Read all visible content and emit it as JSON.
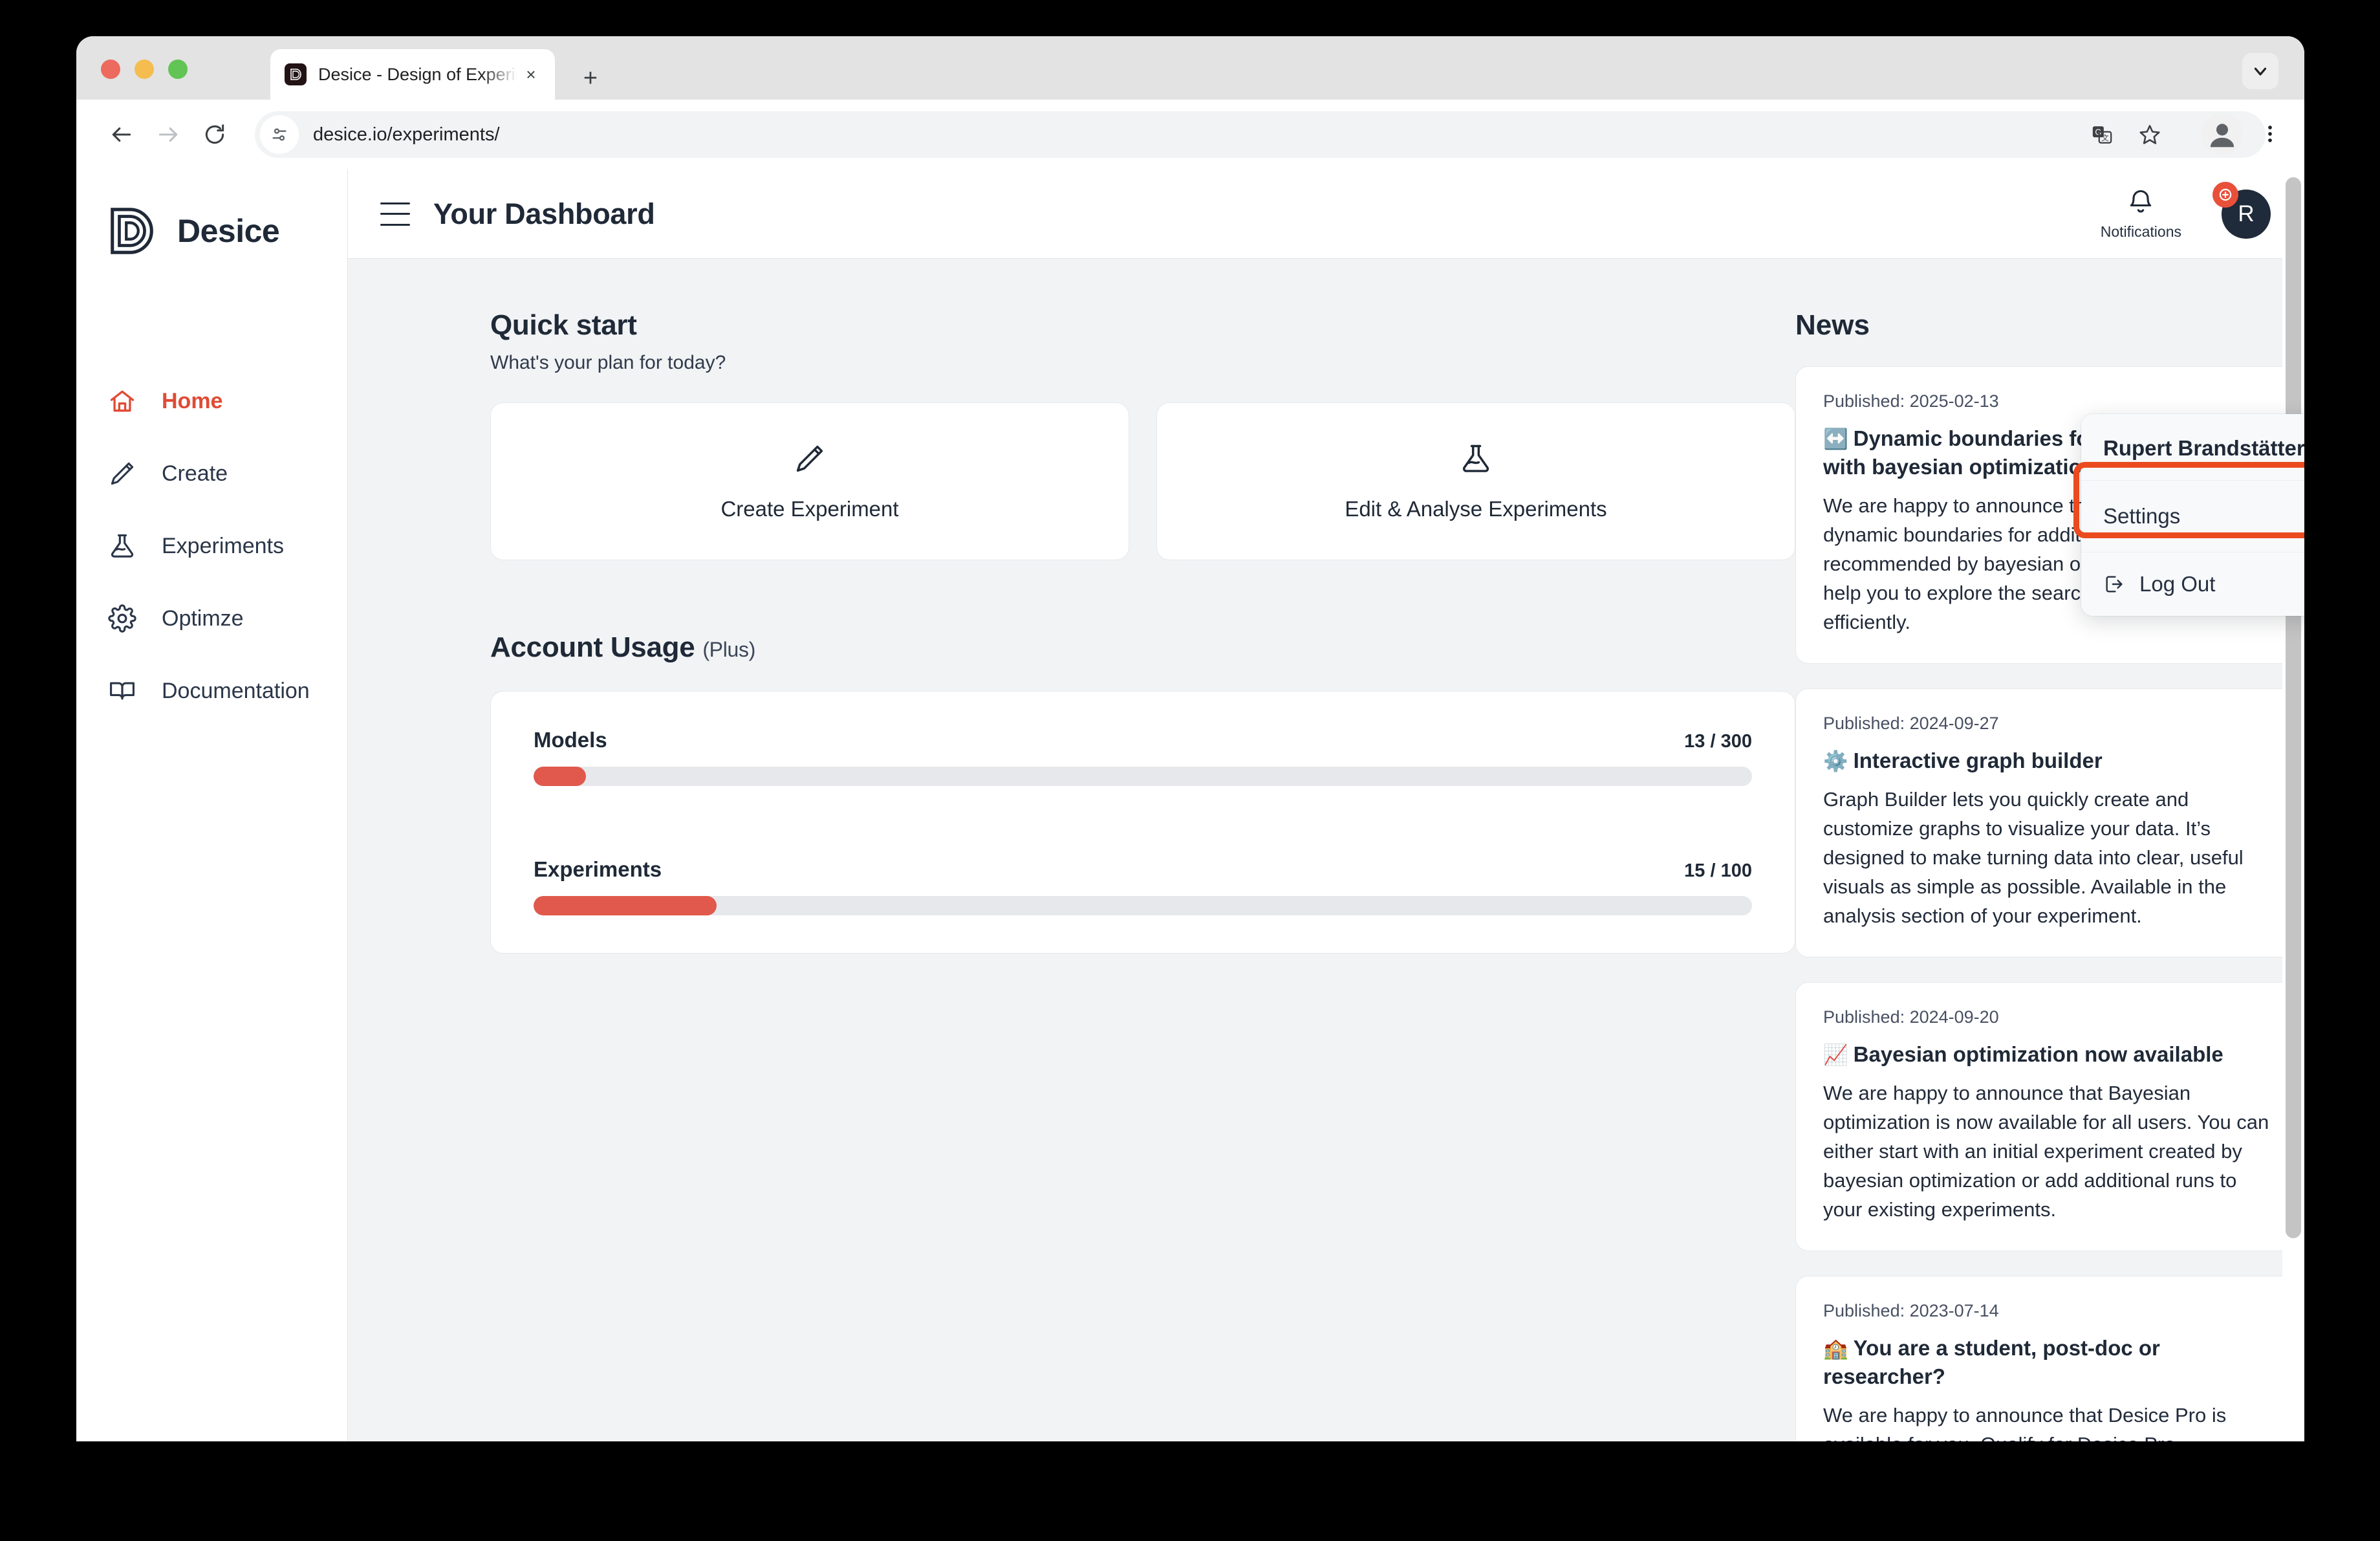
{
  "browser": {
    "tab": {
      "title": "Desice - Design of Experiments",
      "favicon_letter": "D",
      "close_label": "×"
    },
    "new_tab_label": "+",
    "omnibox": {
      "url": "desice.io/experiments/",
      "site_info_icon": "site-settings-icon"
    },
    "toolbar_icons": [
      "translate-icon",
      "bookmark-star-icon",
      "profile-icon",
      "more-menu-icon"
    ],
    "tab_search_icon": "chevron-down-icon"
  },
  "sidebar": {
    "brand": "Desice",
    "items": [
      {
        "label": "Home",
        "icon": "home-icon",
        "active": true
      },
      {
        "label": "Create",
        "icon": "pencil-icon",
        "active": false
      },
      {
        "label": "Experiments",
        "icon": "flask-icon",
        "active": false
      },
      {
        "label": "Optimze",
        "icon": "gear-icon",
        "active": false
      },
      {
        "label": "Documentation",
        "icon": "book-icon",
        "active": false
      }
    ]
  },
  "header": {
    "title": "Your Dashboard",
    "notifications_label": "Notifications",
    "avatar_initial": "R"
  },
  "dropdown": {
    "user_name": "Rupert Brandstätter",
    "settings_label": "Settings",
    "logout_label": "Log Out",
    "highlight_color": "#eb4a1f"
  },
  "quick_start": {
    "title": "Quick start",
    "subtitle": "What's your plan for today?",
    "cards": [
      {
        "label": "Create Experiment",
        "icon": "pencil-icon"
      },
      {
        "label": "Edit & Analyse Experiments",
        "icon": "flask-icon"
      }
    ]
  },
  "account_usage": {
    "title": "Account Usage",
    "plan": "(Plus)",
    "rows": [
      {
        "name": "Models",
        "count": "13 / 300",
        "used": 13,
        "total": 300,
        "percent": 4.3
      },
      {
        "name": "Experiments",
        "count": "15 / 100",
        "used": 15,
        "total": 100,
        "percent": 15
      }
    ],
    "accent_color": "#e0594c"
  },
  "news": {
    "title": "News",
    "items": [
      {
        "published": "Published: 2025-02-13",
        "emoji": "↔️",
        "headline": "Dynamic boundaries for additional runs with bayesian optimization",
        "body": "We are happy to announce that you can now set dynamic boundaries for additional runs recommended by bayesian optimization. This will help you to explore the search space more efficiently."
      },
      {
        "published": "Published: 2024-09-27",
        "emoji": "⚙️",
        "headline": "Interactive graph builder",
        "body": "Graph Builder lets you quickly create and customize graphs to visualize your data. It’s designed to make turning data into clear, useful visuals as simple as possible. Available in the analysis section of your experiment."
      },
      {
        "published": "Published: 2024-09-20",
        "emoji": "📈",
        "headline": "Bayesian optimization now available",
        "body": "We are happy to announce that Bayesian optimization is now available for all users. You can either start with an initial experiment created by bayesian optimization or add additional runs to your existing experiments."
      },
      {
        "published": "Published: 2023-07-14",
        "emoji": "🏫",
        "headline": "You are a student, post-doc or researcher?",
        "body": "We are happy to announce that Desice Pro is available for you. ",
        "link_text": "Qualify for Desice Pro →"
      }
    ]
  }
}
